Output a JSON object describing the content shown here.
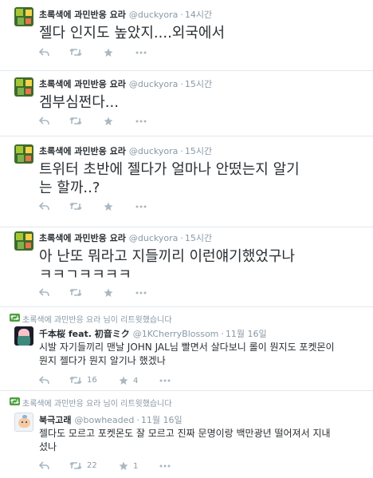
{
  "tweets": [
    {
      "name": "초록색에 과민반응 요라",
      "handle": "@duckyora",
      "time": "14시간",
      "text": "젤다 인지도 높았지....외국에서"
    },
    {
      "name": "초록색에 과민반응 요라",
      "handle": "@duckyora",
      "time": "15시간",
      "text": "겜부심쩐다..."
    },
    {
      "name": "초록색에 과민반응 요라",
      "handle": "@duckyora",
      "time": "15시간",
      "text_line1": "트위터 초반에 젤다가 얼마나 안떴는지 알기",
      "text_line2": "는 할까..?"
    },
    {
      "name": "초록색에 과민반응 요라",
      "handle": "@duckyora",
      "time": "15시간",
      "text_line1": "아 난또 뭐라고 지들끼리 이런얘기했었구나",
      "text_line2": "ㅋㅋㄱㅋㅋㅋㅋ"
    },
    {
      "retweet_note": "초록색에 과민반응 요라 님이 리트윗했습니다",
      "name": "千本桜 feat. 初音ミク",
      "handle": "@1KCherryBlossom",
      "time": "11월 16일",
      "text_line1": "시발 자기들끼리 맨날 JOHN JAL님 빨면서 살다보니 롤이 뭔지도 포켓몬이",
      "text_line2": "뭔지 젤다가 뭔지 알기나 했겠나",
      "retweets": "16",
      "favorites": "4"
    },
    {
      "retweet_note": "초록색에 과민반응 요라 님이 리트윗했습니다",
      "name": "북극고래",
      "handle": "@bowheaded",
      "time": "11월 16일",
      "text_line1": "젤다도 모르고 포켓몬도 잘 모르고 진짜 문명이랑 백만광년 떨어져서 지내",
      "text_line2": "셨나",
      "retweets": "22",
      "favorites": "1"
    }
  ],
  "icons": {
    "reply": "reply-icon",
    "retweet": "retweet-icon",
    "favorite": "star-icon",
    "more": "more-icon"
  },
  "colors": {
    "text": "#292f33",
    "muted": "#8899a6",
    "icon": "#aab8c2",
    "divider": "#e1e8ed",
    "retweet_badge": "#4b9e3d"
  }
}
